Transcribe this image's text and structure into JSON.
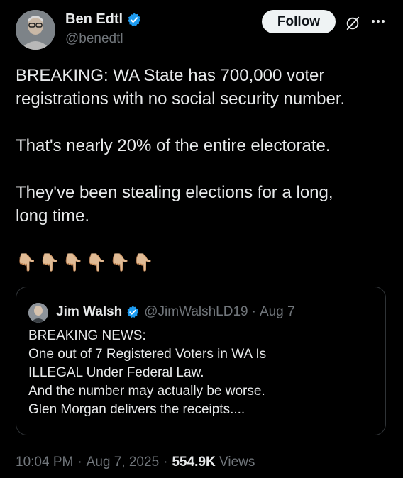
{
  "author": {
    "name": "Ben Edtl",
    "handle": "@benedtl",
    "verified": true
  },
  "actions": {
    "follow_label": "Follow",
    "grok_icon": "grok-icon",
    "more_icon": "more-icon"
  },
  "tweet": {
    "text": "BREAKING: WA State has 700,000 voter\nregistrations with no social security number.\n\nThat's nearly 20% of the entire electorate.\n\nThey've been stealing elections for a long,\nlong time.",
    "emojis": [
      "👇🏼",
      "👇🏼",
      "👇🏼",
      "👇🏼",
      "👇🏼",
      "👇🏼"
    ]
  },
  "quoted_tweet": {
    "name": "Jim Walsh",
    "handle": "@JimWalshLD19",
    "separator": "·",
    "date": "Aug 7",
    "verified": true,
    "text": "BREAKING NEWS:\nOne out of 7 Registered Voters in WA Is\nILLEGAL Under Federal Law.\nAnd the number may actually be worse.\nGlen Morgan delivers the receipts...."
  },
  "meta": {
    "time": "10:04 PM",
    "separator": "·",
    "date": "Aug 7, 2025",
    "views_count": "554.9K",
    "views_label": "Views"
  },
  "colors": {
    "background": "#000000",
    "verified_blue": "#1d9bf0",
    "secondary_text": "#71767b"
  }
}
